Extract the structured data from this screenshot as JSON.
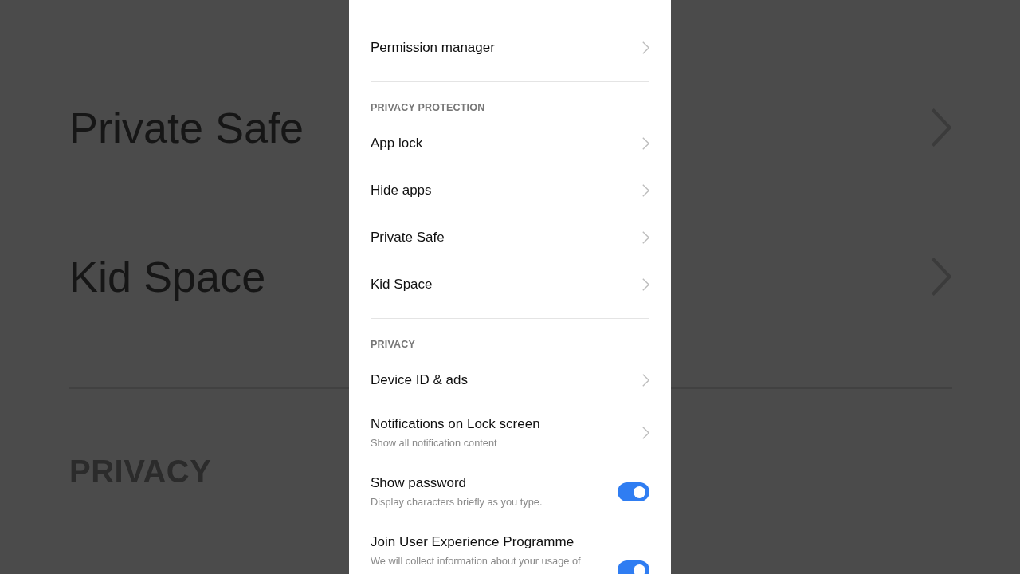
{
  "backdrop": {
    "items": [
      {
        "label": "Private Safe"
      },
      {
        "label": "Kid Space"
      }
    ],
    "section_header": "PRIVACY"
  },
  "settings": {
    "sections": [
      {
        "items": [
          {
            "kind": "link",
            "title": "Permission manager"
          }
        ]
      },
      {
        "header": "PRIVACY PROTECTION",
        "items": [
          {
            "kind": "link",
            "title": "App lock"
          },
          {
            "kind": "link",
            "title": "Hide apps"
          },
          {
            "kind": "link",
            "title": "Private Safe"
          },
          {
            "kind": "link",
            "title": "Kid Space"
          }
        ]
      },
      {
        "header": "PRIVACY",
        "items": [
          {
            "kind": "link",
            "title": "Device ID & ads"
          },
          {
            "kind": "link",
            "title": "Notifications on Lock screen",
            "subtitle": "Show all notification content"
          },
          {
            "kind": "toggle",
            "title": "Show password",
            "subtitle": "Display characters briefly as you type.",
            "on": true
          },
          {
            "kind": "toggle",
            "title": "Join User Experience Programme",
            "subtitle": "We will collect information about your usage of",
            "on": true
          }
        ]
      }
    ]
  }
}
